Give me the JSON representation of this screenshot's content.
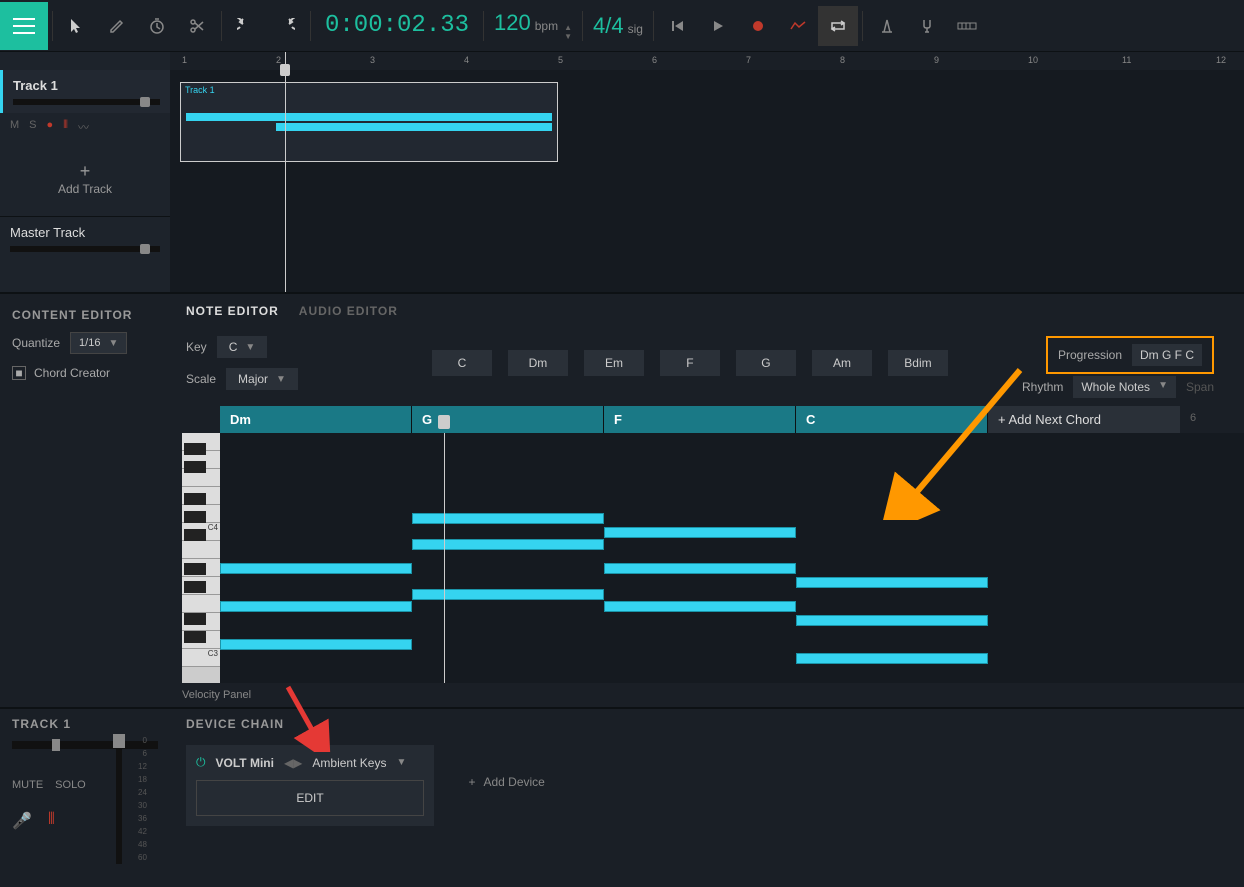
{
  "toolbar": {
    "time": "0:00:02.33",
    "bpm": "120",
    "bpm_label": "bpm",
    "sig": "4/4",
    "sig_label": "sig"
  },
  "track": {
    "name": "Track 1",
    "m": "M",
    "s": "S",
    "add_track": "Add Track",
    "master": "Master Track"
  },
  "ruler_marks": [
    "1",
    "2",
    "3",
    "4",
    "5",
    "6",
    "7",
    "8",
    "9",
    "10",
    "11",
    "12"
  ],
  "clip": {
    "label": "Track 1"
  },
  "content_editor": {
    "title": "CONTENT EDITOR",
    "quantize_label": "Quantize",
    "quantize_value": "1/16",
    "chord_creator": "Chord Creator"
  },
  "editor_tabs": {
    "note": "NOTE EDITOR",
    "audio": "AUDIO EDITOR"
  },
  "key_row": {
    "key_label": "Key",
    "key_value": "C",
    "scale_label": "Scale",
    "scale_value": "Major"
  },
  "chord_buttons": [
    "C",
    "Dm",
    "Em",
    "F",
    "G",
    "Am",
    "Bdim"
  ],
  "progression": {
    "label": "Progression",
    "value": "Dm G F C"
  },
  "rhythm": {
    "label": "Rhythm",
    "value": "Whole Notes",
    "span": "Span"
  },
  "chord_track": [
    "Dm",
    "G",
    "F",
    "C"
  ],
  "add_next_chord": "+ Add Next Chord",
  "ruler2": "6",
  "octaves": {
    "c4": "C4",
    "c3": "C3"
  },
  "velocity_panel": "Velocity Panel",
  "bottom_track": {
    "name": "TRACK 1",
    "mute": "MUTE",
    "solo": "SOLO"
  },
  "device_chain": {
    "title": "DEVICE CHAIN",
    "instrument": "VOLT Mini",
    "preset": "Ambient Keys",
    "edit": "EDIT",
    "add_device": "Add Device"
  },
  "meter_labels": [
    "0",
    "6",
    "12",
    "18",
    "24",
    "30",
    "36",
    "42",
    "48",
    "60"
  ]
}
